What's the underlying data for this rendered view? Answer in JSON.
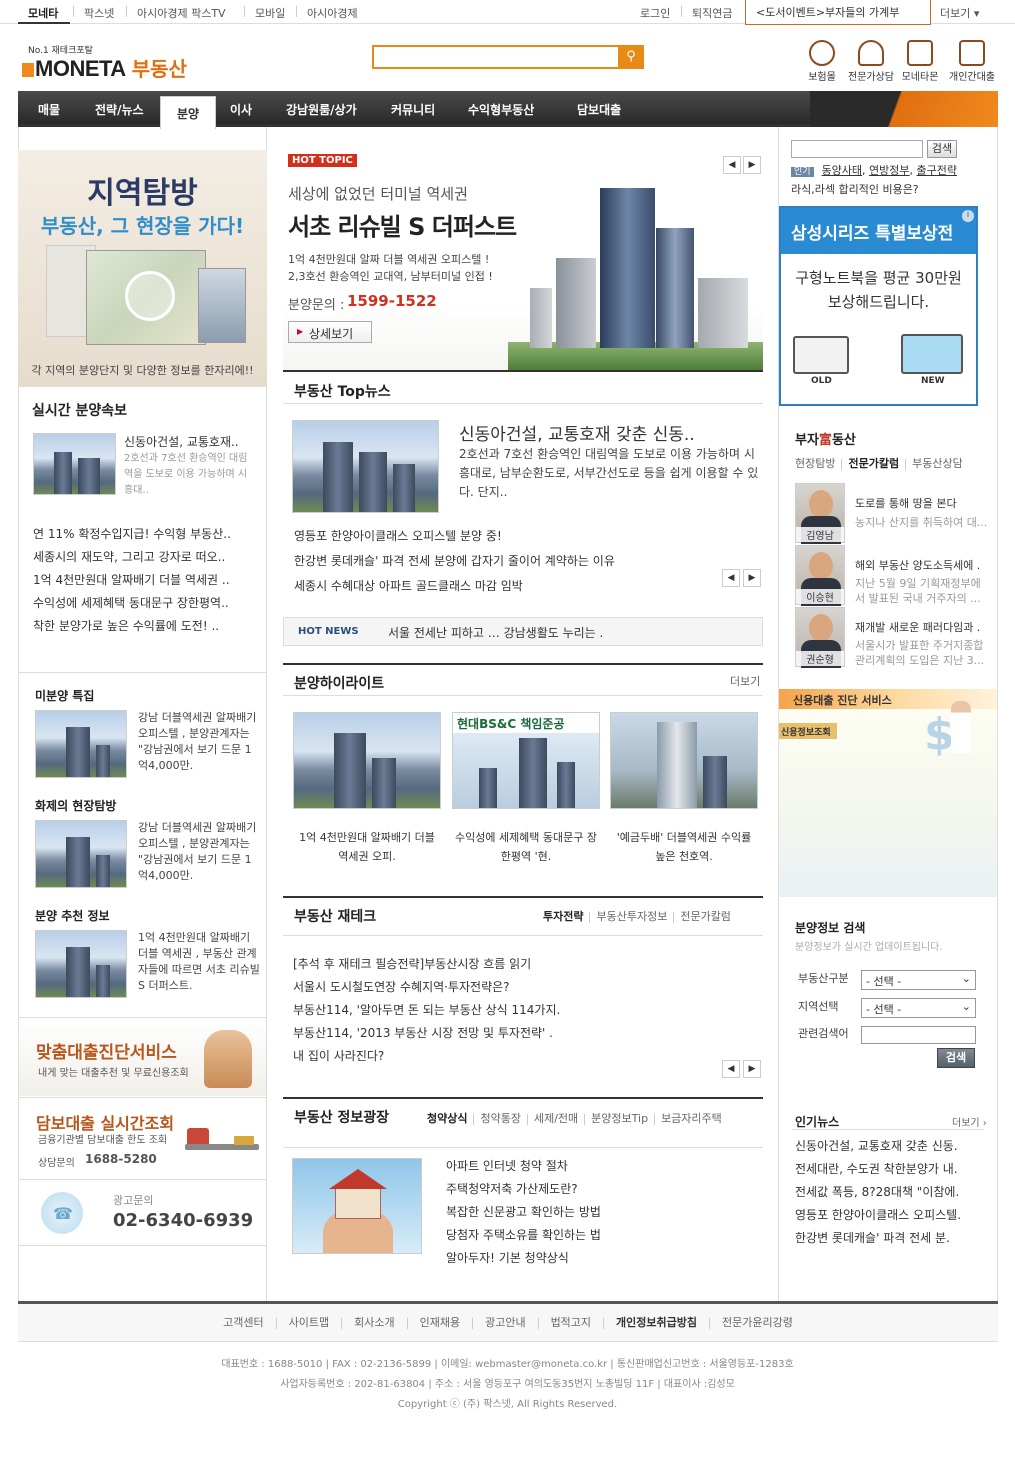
{
  "topbar": {
    "left_items": [
      "모네타",
      "팍스넷",
      "아시아경제 팍스TV",
      "모바일",
      "아시아경제"
    ],
    "right_items": [
      "로그인",
      "퇴직연금"
    ],
    "event": "<도서이벤트>부자들의 가계부",
    "more": "더보기 ▾"
  },
  "header": {
    "logo_sub": "No.1 재테크포탈",
    "logo_text": "MONETA",
    "logo_section": "부동산",
    "search_placeholder": "",
    "icons": [
      {
        "label": "보험몰",
        "icon": "piggy-bank-icon"
      },
      {
        "label": "전문가상담",
        "icon": "people-icon"
      },
      {
        "label": "모네타몬",
        "icon": "gift-icon"
      },
      {
        "label": "개인간대출",
        "icon": "loan-icon"
      }
    ]
  },
  "nav": {
    "items": [
      "매물",
      "전략/뉴스",
      "분양",
      "이사",
      "강남원룸/상가",
      "커뮤니티",
      "수익형부동산",
      "담보대출"
    ],
    "active": "분양"
  },
  "left": {
    "banner_title": "지역탐방",
    "banner_sub": "부동산, 그 현장을 가다!",
    "banner_caption": "각 지역의 분양단지 및 다양한 정보를 한자리에!!",
    "realtime_title": "실시간 분양속보",
    "realtime_feature_title": "신동아건설, 교통호재..",
    "realtime_feature_desc": "2호선과 7호선 환승역인 대림역을 도보로 이용 가능하며 시흥대..",
    "realtime_list": [
      "연 11% 확정수입지급! 수익형 부동산..",
      "세종시의 재도약, 그리고 강자로 떠오..",
      "1억 4천만원대 알짜배기 더블 역세권 ..",
      "수익성에 세제혜택 동대문구 장한평역..",
      "착한 분양가로 높은 수익률에 도전! .."
    ],
    "sections": [
      {
        "title": "미분양 특집",
        "desc": "강남 더블역세권 알짜배기 오피스텔 , 분양관계자는 \"강남권에서 보기 드문 1억4,000만."
      },
      {
        "title": "화제의 현장탐방",
        "desc": "강남 더블역세권 알짜배기 오피스텔 , 분양관계자는 \"강남권에서 보기 드문 1억4,000만."
      },
      {
        "title": "분양 추천 정보",
        "desc": "1억 4천만원대 알짜배기 더블 역세권 , 부동산 관계자들에 따르면 서초 리슈빌S 더퍼스트."
      }
    ],
    "loan_banner_title": "맞춤대출진단서비스",
    "loan_banner_sub": "내게 맞는 대출추천 및 무료신용조회",
    "mortgage_title": "담보대출 실시간조회",
    "mortgage_sub": "금융기관별 담보대출 한도 조회",
    "mortgage_phone_label": "상담문의",
    "mortgage_phone": "1688-5280",
    "ad_label": "광고문의",
    "ad_phone": "02-6340-6939"
  },
  "center": {
    "hot_topic_badge": "HOT TOPIC",
    "hot_sub": "세상에 없었던 터미널 역세권",
    "hot_title": "서초 리슈빌 S 더퍼스트",
    "hot_desc1": "1억 4천만원대 알짜 더블 역세권 오피스텔 !",
    "hot_desc2": "2,3호선 환승역인 교대역, 남부터미널 인접 !",
    "hot_phone_label": "분양문의 :",
    "hot_phone": "1599-1522",
    "hot_button": "상세보기",
    "topnews_title": "부동산 Top뉴스",
    "topnews_feature_title": "신동아건설, 교통호재 갖춘 신동..",
    "topnews_feature_desc": "2호선과 7호선 환승역인 대림역을 도보로 이용 가능하며 시흥대로, 남부순환도로, 서부간선도로 등을 쉽게 이용할 수 있다. 단지..",
    "topnews_list": [
      "영등포 한양아이클래스 오피스텔 분양 중!",
      "한강변 롯데캐슬' 파격 전세 분양에 갑자기 줄이어 계약하는 이유",
      "세종시 수혜대상 아파트 골드클래스 마감 임박"
    ],
    "hotnews_label": "HOT NEWS",
    "hotnews_text": "서울 전세난 피하고 … 강남생활도 누리는 .",
    "highlight_title": "분양하이라이트",
    "highlight_more": "더보기",
    "highlights": [
      {
        "caption": "1억 4천만원대 알짜배기 더블 역세권 오피."
      },
      {
        "caption": "수익성에 세제혜택 동대문구 장한평역 '현.",
        "badge": "현대BS&C 책임준공"
      },
      {
        "caption": "'예금두배' 더블역세권 수익률 높은 천호역."
      }
    ],
    "tech_title": "부동산 재테크",
    "tech_tabs": [
      "투자전략",
      "부동산투자정보",
      "전문가칼럼"
    ],
    "tech_list": [
      "[추석 후 재테크 필승전략]부동산시장 흐름 읽기",
      "서울시 도시철도연장 수혜지역·투자전략은?",
      "부동산114, '알아두면 돈 되는 부동산 상식 114가지.",
      "부동산114, '2013 부동산 시장 전망 및 투자전략' .",
      "내 집이 사라진다?"
    ],
    "info_title": "부동산 정보광장",
    "info_tabs": [
      "청약상식",
      "청약통장",
      "세제/전매",
      "분양정보Tip",
      "보금자리주택"
    ],
    "info_list": [
      "아파트 인터넷 청약 절차",
      "주택청약저축 가산제도란?",
      "복잡한 신문광고 확인하는 방법",
      "당첨자 주택소유를 확인하는 법",
      "알아두자! 기본 청약상식"
    ]
  },
  "right": {
    "search_button": "검색",
    "popular_label": "인기",
    "popular_keywords": [
      "동양사태",
      "연방정부",
      "출구전략"
    ],
    "popular_line2": "라식,라섹 합리적인 비용은?",
    "samsung_title": "삼성시리즈 특별보상전",
    "samsung_text": "구형노트북을 평균 30만원 보상해드립니다.",
    "samsung_old": "OLD",
    "samsung_new": "NEW",
    "rich_title_pre": "부자",
    "rich_title_mid": "富",
    "rich_title_post": "동산",
    "rich_tabs": [
      "현장탐방",
      "전문가칼럼",
      "부동산상담"
    ],
    "columns": [
      {
        "name": "김영남",
        "title": "도로를 통해 땅을 본다",
        "desc": "농지나 산지를 취득하여 대..."
      },
      {
        "name": "이승현",
        "title": "해외 부동산 양도소득세에 .",
        "desc": "지난 5월 9일 기획재정부에서 발표된 국내 거주자의 ..."
      },
      {
        "name": "권순형",
        "title": "재개발 새로운 패러다임과 .",
        "desc": "서울시가 발표한 주거지종합 관리계획의 도입은 지난 3..."
      }
    ],
    "credit_title": "신용대출 진단 서비스",
    "credit_tag": "신용정보조회",
    "search_title": "분양정보 검색",
    "search_sub": "분양정보가 실시간 업데이트됩니다.",
    "search_fields": [
      {
        "label": "부동산구분",
        "value": "- 선택 -"
      },
      {
        "label": "지역선택",
        "value": "- 선택 -"
      },
      {
        "label": "관련검색어",
        "value": ""
      }
    ],
    "search_submit": "검색",
    "popular_news_title": "인기뉴스",
    "popular_news_more": "더보기 ›",
    "popular_news": [
      "신동아건설, 교통호재 갖춘 신동.",
      "전세대란, 수도권 착한분양가 내.",
      "전세값 폭등, 8?28대책 \"이참에.",
      "영등포 한양아이클래스 오피스텔.",
      "한강변 롯데캐슬' 파격 전세 분."
    ]
  },
  "footer": {
    "links": [
      "고객센터",
      "사이트맵",
      "회사소개",
      "인재채용",
      "광고안내",
      "법적고지",
      "개인정보취급방침",
      "전문가윤리강령"
    ],
    "line1": "대표번호 : 1688-5010 | FAX : 02-2136-5899 | 이메일: webmaster@moneta.co.kr | 통신판매업신고번호 : 서울영등포-1283호",
    "line2": "사업자등록번호 : 202-81-63804 | 주소 : 서울 영등포구 여의도동35번지 노총빌딩 11F | 대표이사 :김성모",
    "line3": "Copyright ⓒ (주) 팍스넷, All Rights Reserved."
  }
}
